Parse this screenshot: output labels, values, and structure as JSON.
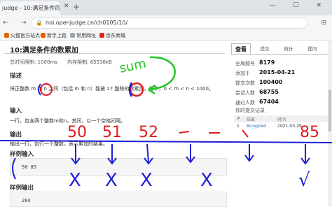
{
  "browser": {
    "tab_title": "judge - 10:满足条件的数",
    "tab_close": "✕",
    "new_tab": "+",
    "window_controls": "— ☐ ✕",
    "nav_glyphs": "← → ⟳",
    "lock_glyph": "🔒",
    "url": "noi.openjudge.cn/ch0105/10/",
    "side_glyph": "⊞",
    "bookmarks": [
      {
        "label": "火狐官方站点",
        "color": "#e66000"
      },
      {
        "label": "新手上路",
        "color": "#e66000"
      },
      {
        "label": "常用网址",
        "color": "#9aa4ad"
      },
      {
        "label": "京东商城",
        "color": "#e1251b"
      }
    ]
  },
  "problem": {
    "title": "10:满足条件的数累加",
    "time_limit": "总时间限制: 1000ms",
    "memory_limit": "内存限制: 65536kB",
    "desc_heading": "描述",
    "desc_text": "将正整数 m 和 n 之间（包括 m 和 n）能被 17 整除的数累加，其中，0 < m < n < 1000。",
    "input_heading": "输入",
    "input_text": "一行，包含两个整数m和n，其间，以一个空格间隔。",
    "output_heading": "输出",
    "output_text": "输出一行，包行一个整数，表示累加的结果。",
    "sample_input_heading": "样例输入",
    "sample_input": "50 85",
    "sample_output_heading": "样例输出",
    "sample_output": "204"
  },
  "side_panel": {
    "tabs": [
      "查看",
      "提交",
      "统计",
      "提问"
    ],
    "stats": [
      {
        "label": "全局题号",
        "value": "8179"
      },
      {
        "label": "添加于",
        "value": "2015-04-21"
      },
      {
        "label": "提交次数",
        "value": "100400"
      },
      {
        "label": "尝试人数",
        "value": "68755"
      },
      {
        "label": "通过人数",
        "value": "67404"
      }
    ],
    "records_title": "你的提交记录",
    "records_headers": [
      "#",
      "结果",
      "时间"
    ],
    "records": [
      {
        "num": "1",
        "result": "Accepted",
        "time": "2021-03-29"
      }
    ]
  },
  "annotations": {
    "sum_label": "sum",
    "highlight_m": "m",
    "highlight_n": "n",
    "numbers": [
      "50",
      "51",
      "52",
      "85"
    ],
    "cross_mark": "X",
    "check_mark": "√",
    "color": "#1f1fd6",
    "accent_color": "#22c622",
    "red_color": "#e01b1b"
  }
}
